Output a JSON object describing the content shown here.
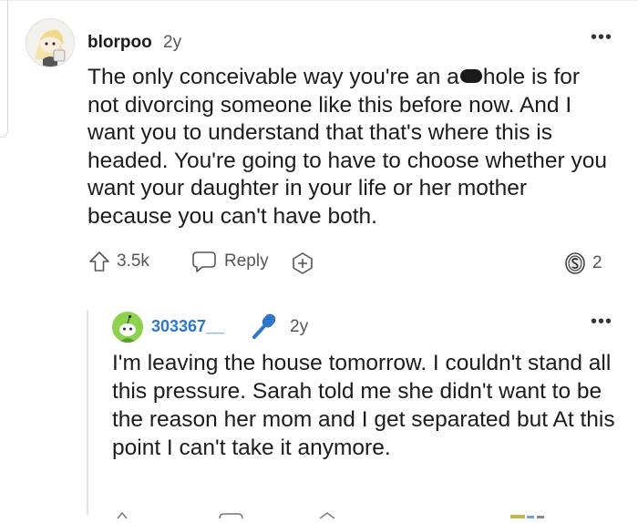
{
  "comment": {
    "username": "blorpoo",
    "time": "2y",
    "more": "•••",
    "text_before_redaction": "The only conceivable way you're an a",
    "text_after_redaction": "hole is for not divorcing someone like this before now. And I want you to understand that that's where this is headed. You're going to have to choose whether you want your daughter in your life or her mother because you can't have both.",
    "upvotes": "3.5k",
    "reply_label": "Reply",
    "coin_count": "2",
    "icons": [
      "avatar",
      "upvote-icon",
      "reply-icon",
      "award-icon",
      "coin-icon",
      "more-options-icon"
    ]
  },
  "reply": {
    "username": "303367__",
    "time": "2y",
    "more": "•••",
    "text": "I'm leaving the house tomorrow. I couldn't stand all this pressure. Sarah told me she didn't want to be the reason her mom and I get separated but At this point I can't take it anymore.",
    "icons": [
      "avatar",
      "microphone-icon",
      "more-options-icon"
    ]
  },
  "colors": {
    "username_reply": "#2e77c8",
    "mic": "#2e77c8",
    "avatar_reply": "#8ed14f",
    "meta_text": "#555555"
  }
}
